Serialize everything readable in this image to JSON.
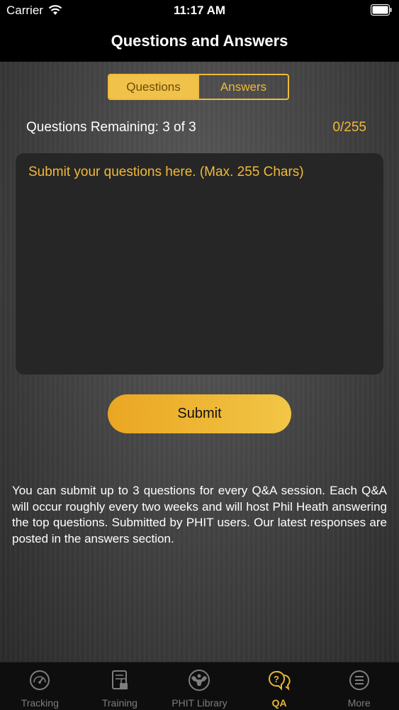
{
  "status": {
    "carrier": "Carrier",
    "time": "11:17 AM",
    "wifi_icon": "wifi-icon",
    "battery_icon": "battery-icon"
  },
  "nav": {
    "title": "Questions and Answers"
  },
  "segment": {
    "questions": "Questions",
    "answers": "Answers",
    "selected": "Questions"
  },
  "remaining": "Questions Remaining: 3 of 3",
  "counter": "0/255",
  "textarea": {
    "placeholder": "Submit your questions here. (Max. 255 Chars)",
    "value": ""
  },
  "submit_label": "Submit",
  "info": "You can submit up to 3 questions for every Q&A session. Each Q&A will occur roughly every two weeks and will host Phil Heath answering the top questions. Submitted by PHIT users. Our latest responses are posted in the answers section.",
  "tabs": [
    {
      "label": "Tracking",
      "icon": "gauge-icon",
      "active": false
    },
    {
      "label": "Training",
      "icon": "clipboard-lock-icon",
      "active": false
    },
    {
      "label": "PHIT Library",
      "icon": "bodybuilder-icon",
      "active": false
    },
    {
      "label": "QA",
      "icon": "question-chat-icon",
      "active": true
    },
    {
      "label": "More",
      "icon": "menu-circle-icon",
      "active": false
    }
  ],
  "colors": {
    "accent": "#f0b93b",
    "tab_inactive": "#7d7d7d",
    "text_area_bg": "#262626"
  }
}
